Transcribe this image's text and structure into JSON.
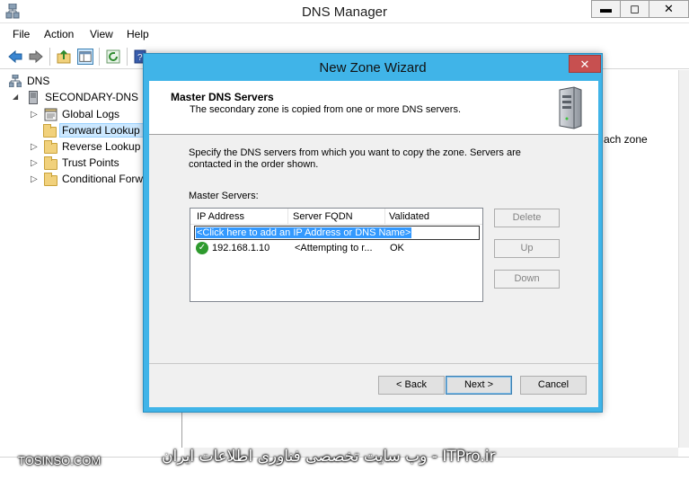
{
  "app": {
    "title": "DNS Manager"
  },
  "window_controls": {
    "minimize": "▬",
    "maximize": "◻",
    "close": "✕"
  },
  "menu": [
    "File",
    "Action",
    "View",
    "Help"
  ],
  "tree": {
    "items": [
      {
        "label": "DNS",
        "level": 0
      },
      {
        "label": "SECONDARY-DNS",
        "level": 1
      },
      {
        "label": "Global Logs",
        "level": 2
      },
      {
        "label": "Forward Lookup Z",
        "level": 2,
        "selected": true
      },
      {
        "label": "Reverse Lookup Z",
        "level": 2
      },
      {
        "label": "Trust Points",
        "level": 2
      },
      {
        "label": "Conditional Forw",
        "level": 2
      }
    ]
  },
  "right_pane": {
    "text": "ach zone"
  },
  "wizard": {
    "title": "New Zone Wizard",
    "close": "✕",
    "header_title": "Master DNS Servers",
    "header_subtitle": "The secondary zone is copied from one or more DNS servers.",
    "description": "Specify the DNS servers from which you want to copy the zone.  Servers are contacted in the order shown.",
    "list_label": "Master Servers:",
    "columns": [
      "IP Address",
      "Server FQDN",
      "Validated"
    ],
    "add_row_text": "<Click here to add an IP Address or DNS Name>",
    "rows": [
      {
        "ip": "192.168.1.10",
        "fqdn": "<Attempting to r...",
        "validated": "OK"
      }
    ],
    "side_buttons": [
      "Delete",
      "Up",
      "Down"
    ],
    "footer_buttons": {
      "back": "< Back",
      "next": "Next >",
      "cancel": "Cancel"
    }
  },
  "watermark": {
    "left": "TOSINSO.COM",
    "right": "ITPro.ir - وب سایت تخصصی فناوری اطلاعات ایران"
  }
}
